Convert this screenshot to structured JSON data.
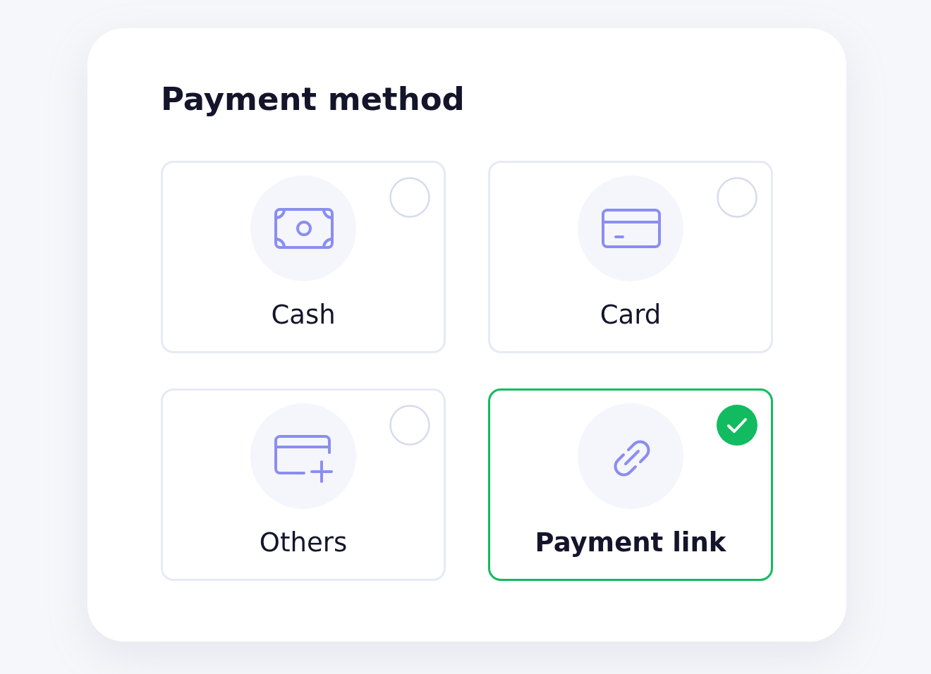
{
  "title": "Payment method",
  "options": [
    {
      "label": "Cash",
      "kind": "cash",
      "selected": false
    },
    {
      "label": "Card",
      "kind": "card",
      "selected": false
    },
    {
      "label": "Others",
      "kind": "others",
      "selected": false
    },
    {
      "label": "Payment link",
      "kind": "link",
      "selected": true
    }
  ]
}
